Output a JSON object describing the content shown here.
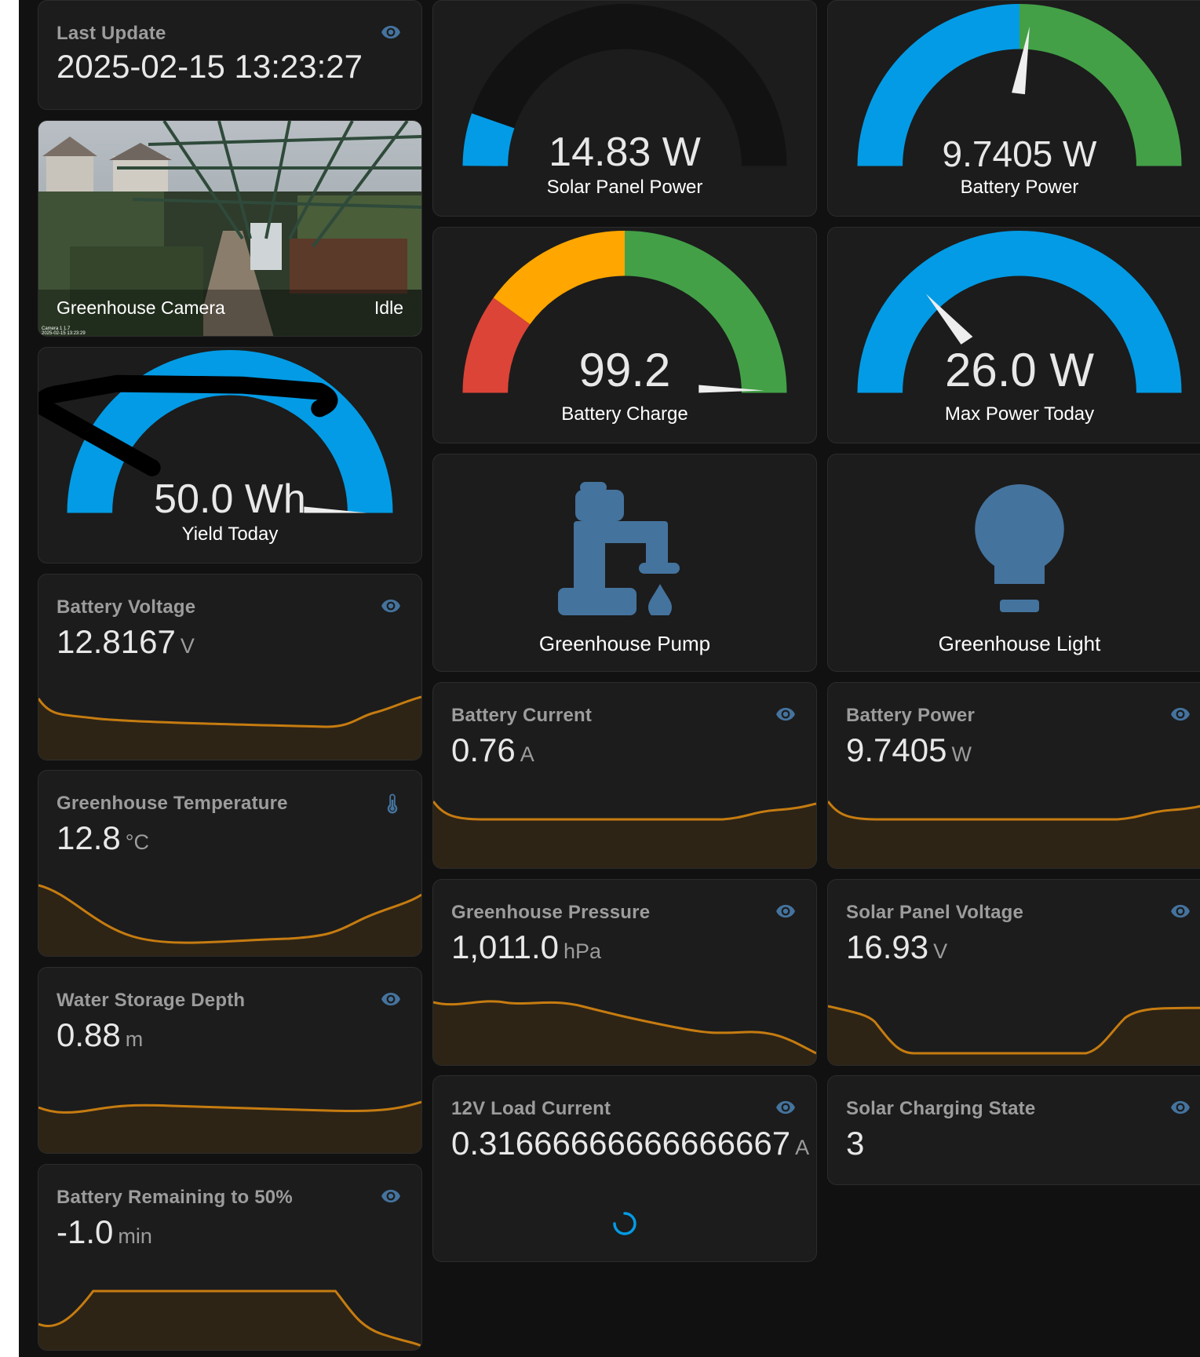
{
  "last_update": {
    "label": "Last Update",
    "value": "2025-02-15 13:23:27",
    "icon": "eye-icon"
  },
  "camera": {
    "name": "Greenhouse Camera",
    "state": "Idle",
    "overlay_line1": "Camera 1 1.7",
    "overlay_line2": "2025-02-15 13:23:29"
  },
  "gauges": {
    "yield_today": {
      "value": "50.0 Wh",
      "name": "Yield Today"
    },
    "solar_panel_power": {
      "value": "14.83 W",
      "name": "Solar Panel Power",
      "fraction": 0.12
    },
    "battery_power": {
      "value": "9.7405 W",
      "name": "Battery Power",
      "fraction": 0.53
    },
    "battery_charge": {
      "value": "99.2",
      "name": "Battery Charge",
      "fraction": 0.992,
      "segments": [
        "#db4437",
        "#ffa600",
        "#43a047"
      ]
    },
    "max_power_today": {
      "value": "26.0 W",
      "name": "Max Power Today",
      "fraction": 0.26
    }
  },
  "buttons": {
    "pump": {
      "label": "Greenhouse Pump",
      "icon": "water-pump-icon"
    },
    "light": {
      "label": "Greenhouse Light",
      "icon": "lightbulb-icon"
    }
  },
  "sensors": {
    "battery_voltage": {
      "title": "Battery Voltage",
      "value": "12.8167",
      "unit": "V",
      "icon": "eye-icon"
    },
    "greenhouse_temperature": {
      "title": "Greenhouse Temperature",
      "value": "12.8",
      "unit": "°C",
      "icon": "thermometer-icon"
    },
    "water_storage_depth": {
      "title": "Water Storage Depth",
      "value": "0.88",
      "unit": "m",
      "icon": "eye-icon"
    },
    "battery_remaining": {
      "title": "Battery Remaining to 50%",
      "value": "-1.0",
      "unit": "min",
      "icon": "eye-icon"
    },
    "battery_current": {
      "title": "Battery Current",
      "value": "0.76",
      "unit": "A",
      "icon": "eye-icon"
    },
    "battery_power": {
      "title": "Battery Power",
      "value": "9.7405",
      "unit": "W",
      "icon": "eye-icon"
    },
    "greenhouse_pressure": {
      "title": "Greenhouse Pressure",
      "value": "1,011.0",
      "unit": "hPa",
      "icon": "eye-icon"
    },
    "solar_panel_voltage": {
      "title": "Solar Panel Voltage",
      "value": "16.93",
      "unit": "V",
      "icon": "eye-icon"
    },
    "load_current": {
      "title": "12V Load Current",
      "value": "0.31666666666666667",
      "unit": "A",
      "icon": "eye-icon"
    },
    "solar_charging_state": {
      "title": "Solar Charging State",
      "value": "3",
      "icon": "eye-icon"
    }
  },
  "colors": {
    "accent": "#039be5",
    "icon_blue": "#44739e",
    "graph_line": "#c67c10",
    "graph_fill": "#2e2416",
    "gauge_track": "#121212",
    "card_bg": "#1c1c1c"
  }
}
